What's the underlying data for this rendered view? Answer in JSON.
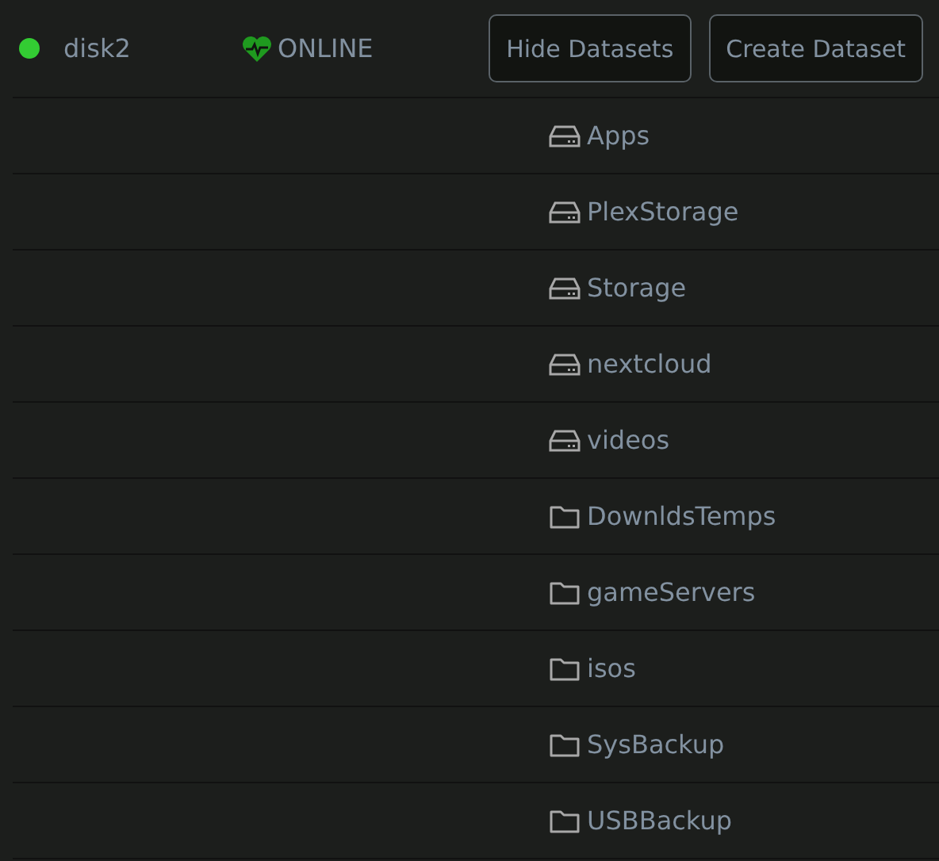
{
  "pool": {
    "name": "disk2",
    "color": "#33cc33",
    "status": "ONLINE"
  },
  "buttons": [
    "Hide Datasets",
    "Create Dataset"
  ],
  "datasets": [
    {
      "name": "Apps",
      "kind": "drive"
    },
    {
      "name": "PlexStorage",
      "kind": "drive"
    },
    {
      "name": "Storage",
      "kind": "drive"
    },
    {
      "name": "nextcloud",
      "kind": "drive"
    },
    {
      "name": "videos",
      "kind": "drive"
    },
    {
      "name": "DownldsTemps",
      "kind": "folder"
    },
    {
      "name": "gameServers",
      "kind": "folder"
    },
    {
      "name": "isos",
      "kind": "folder"
    },
    {
      "name": "SysBackup",
      "kind": "folder"
    },
    {
      "name": "USBBackup",
      "kind": "folder"
    }
  ]
}
